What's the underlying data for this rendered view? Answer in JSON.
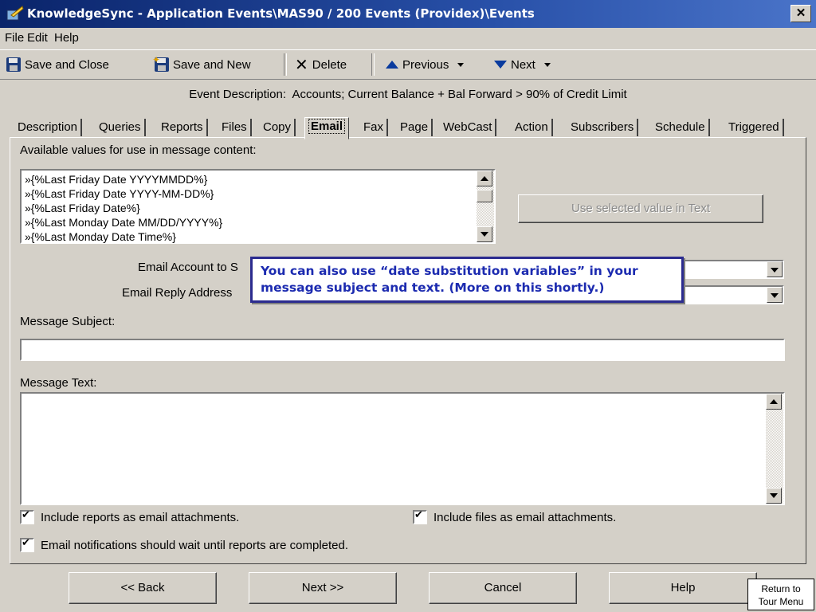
{
  "window": {
    "title": "KnowledgeSync - Application Events\\MAS90 / 200  Events (Providex)\\Events",
    "close_glyph": "✕"
  },
  "menu": [
    "File",
    "Edit",
    "Help"
  ],
  "toolbar": {
    "save_close": "Save and Close",
    "save_new": "Save and New",
    "delete": "Delete",
    "previous": "Previous",
    "next": "Next"
  },
  "event": {
    "label": "Event Description:",
    "value": "Accounts; Current Balance + Bal Forward > 90% of Credit Limit"
  },
  "tabs": [
    "Description",
    "Queries",
    "Reports",
    "Files",
    "Copy",
    "Email",
    "Fax",
    "Page",
    "WebCast",
    "Action",
    "Subscribers",
    "Schedule",
    "Triggered"
  ],
  "active_tab": "Email",
  "email": {
    "available_label": "Available values for use in message content:",
    "values": [
      "»{%Last Friday Date YYYYMMDD%}",
      "»{%Last Friday Date YYYY-MM-DD%}",
      "»{%Last Friday Date%}",
      "»{%Last Monday Date MM/DD/YYYY%}",
      "»{%Last Monday Date Time%}"
    ],
    "use_selected_button": "Use selected value in Text",
    "account_label": "Email Account to S",
    "reply_label": "Email Reply Address",
    "subject_label": "Message Subject:",
    "subject_value": "",
    "text_label": "Message Text:",
    "text_value": "",
    "checks": {
      "include_reports": "Include reports as email attachments.",
      "include_files": "Include files as email attachments.",
      "wait_reports": "Email notifications should wait until reports are completed."
    }
  },
  "callout": {
    "line1": "You can also use “date substitution variables” in your",
    "line2": "message subject and text. (More on this shortly.)"
  },
  "nav": {
    "back": "<< Back",
    "next": "Next >>",
    "cancel": "Cancel",
    "help": "Help"
  },
  "tour_menu": {
    "line1": "Return to",
    "line2": "Tour Menu"
  }
}
